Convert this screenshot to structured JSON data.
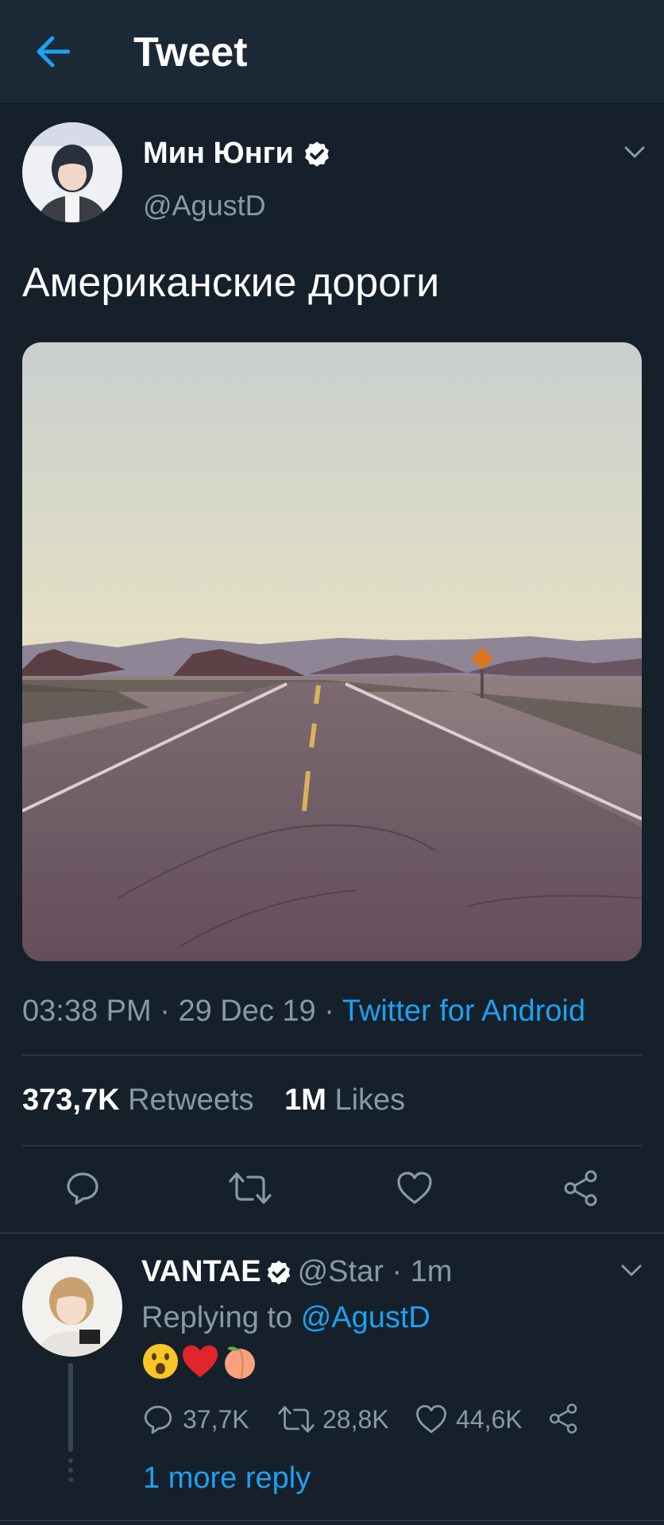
{
  "header": {
    "title": "Tweet",
    "back_icon": "arrow-left-icon"
  },
  "tweet": {
    "author_name": "Мин Юнги",
    "author_handle": "@AgustD",
    "verified": true,
    "text": "Американские дороги",
    "time": "03:38 PM",
    "date": "29 Dec 19",
    "separator": " · ",
    "source": "Twitter for Android",
    "retweets_count": "373,7K",
    "retweets_label": "Retweets",
    "likes_count": "1M",
    "likes_label": "Likes",
    "actions": [
      "reply-icon",
      "retweet-icon",
      "like-icon",
      "share-icon"
    ]
  },
  "reply": {
    "author_name": "VANTAE",
    "author_handle": "@Star",
    "separator": " · ",
    "time": "1m",
    "replying_prefix": "Replying to",
    "replying_to": "@AgustD",
    "emojis": [
      "astonished-face",
      "red-heart",
      "peach"
    ],
    "reply_count": "37,7K",
    "retweet_count": "28,8K",
    "like_count": "44,6K",
    "more_replies": "1 more reply"
  },
  "colors": {
    "background": "#15202b",
    "header": "#1b2836",
    "accent": "#1da1f2",
    "secondary_text": "#8899a6",
    "divider": "#38444d"
  }
}
